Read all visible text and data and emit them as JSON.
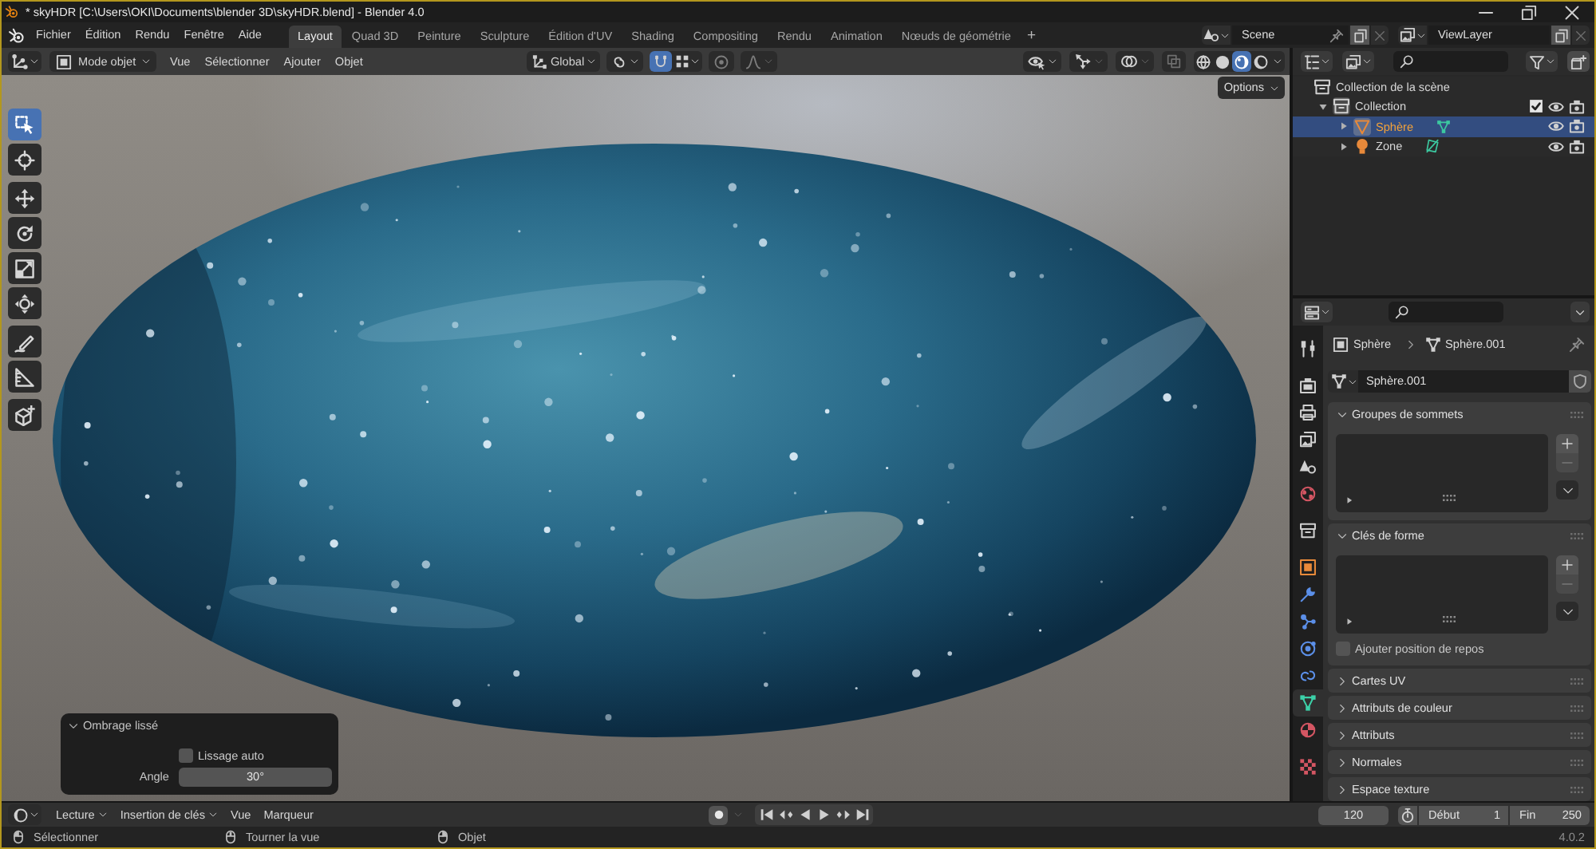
{
  "window": {
    "title": "* skyHDR [C:\\Users\\OKI\\Documents\\blender 3D\\skyHDR.blend] - Blender 4.0"
  },
  "menu": [
    "Fichier",
    "Édition",
    "Rendu",
    "Fenêtre",
    "Aide"
  ],
  "workspaces": [
    {
      "label": "Layout",
      "selected": true
    },
    {
      "label": "Quad 3D",
      "selected": false
    },
    {
      "label": "Peinture",
      "selected": false
    },
    {
      "label": "Sculpture",
      "selected": false
    },
    {
      "label": "Édition d'UV",
      "selected": false
    },
    {
      "label": "Shading",
      "selected": false
    },
    {
      "label": "Compositing",
      "selected": false
    },
    {
      "label": "Rendu",
      "selected": false
    },
    {
      "label": "Animation",
      "selected": false
    },
    {
      "label": "Nœuds de géométrie",
      "selected": false
    }
  ],
  "add_workspace": "+",
  "scene": {
    "value": "Scene"
  },
  "view_layer": {
    "value": "ViewLayer"
  },
  "viewport": {
    "mode": "Mode objet",
    "menus": [
      "Vue",
      "Sélectionner",
      "Ajouter",
      "Objet"
    ],
    "orientation": "Global",
    "snap": {
      "on": true
    },
    "shading": [
      {
        "kind": "wireframe",
        "selected": false
      },
      {
        "kind": "solid",
        "selected": false
      },
      {
        "kind": "material",
        "selected": true
      },
      {
        "kind": "rendered",
        "selected": false
      }
    ],
    "tool_groups": [
      [
        {
          "kind": "select_box",
          "selected": true
        },
        {
          "kind": "cursor",
          "selected": false
        }
      ],
      [
        {
          "kind": "move",
          "selected": false
        },
        {
          "kind": "rotate",
          "selected": false
        },
        {
          "kind": "scale",
          "selected": false
        },
        {
          "kind": "transform",
          "selected": false
        }
      ],
      [
        {
          "kind": "annotate",
          "selected": false
        },
        {
          "kind": "measure",
          "selected": false
        }
      ],
      [
        {
          "kind": "add_cube",
          "selected": false
        }
      ]
    ],
    "options": "Options",
    "last_operator": {
      "title": "Ombrage lissé",
      "expanded": true,
      "auto_smooth": {
        "label": "Lissage auto",
        "checked": false
      },
      "angle": {
        "label": "Angle",
        "value": "30°"
      }
    }
  },
  "outliner": {
    "tree": [
      {
        "label": "Collection de la scène",
        "children": [
          {
            "label": "Collection",
            "expanded": true,
            "checked": true,
            "children": [
              {
                "label": "Sphère",
                "kind": "mesh",
                "selected": true,
                "expanded": false
              },
              {
                "label": "Zone",
                "kind": "light",
                "selected": false,
                "expanded": false
              }
            ]
          }
        ]
      }
    ]
  },
  "properties": {
    "tab_groups": [
      [
        {
          "kind": "tool",
          "selected": false
        }
      ],
      [
        {
          "kind": "render",
          "selected": false
        },
        {
          "kind": "output",
          "selected": false
        },
        {
          "kind": "view_layer",
          "selected": false
        },
        {
          "kind": "scene",
          "selected": false
        },
        {
          "kind": "world",
          "selected": false
        }
      ],
      [
        {
          "kind": "collection",
          "selected": false
        }
      ],
      [
        {
          "kind": "object",
          "selected": false
        },
        {
          "kind": "modifiers",
          "selected": false
        },
        {
          "kind": "particles",
          "selected": false
        },
        {
          "kind": "physics",
          "selected": false
        },
        {
          "kind": "constraints",
          "selected": false
        },
        {
          "kind": "data",
          "selected": true
        },
        {
          "kind": "material",
          "selected": false
        }
      ],
      [
        {
          "kind": "texture",
          "selected": false
        }
      ]
    ],
    "breadcrumb": [
      "Sphère",
      "Sphère.001"
    ],
    "mesh": {
      "value": "Sphère.001"
    },
    "panels": [
      {
        "title": "Groupes de sommets",
        "expanded": true,
        "kind": "list"
      },
      {
        "title": "Clés de forme",
        "expanded": true,
        "kind": "list",
        "checkbox": {
          "label": "Ajouter position de repos",
          "checked": false
        }
      },
      {
        "title": "Cartes UV",
        "expanded": false
      },
      {
        "title": "Attributs de couleur",
        "expanded": false
      },
      {
        "title": "Attributs",
        "expanded": false
      },
      {
        "title": "Normales",
        "expanded": false
      },
      {
        "title": "Espace texture",
        "expanded": false
      }
    ]
  },
  "timeline": {
    "menus": [
      {
        "label": "Lecture",
        "kind": "dropdown"
      },
      {
        "label": "Insertion de clés",
        "kind": "dropdown"
      },
      {
        "label": "Vue",
        "kind": "menu"
      },
      {
        "label": "Marqueur",
        "kind": "menu"
      }
    ],
    "current_frame": "120",
    "start": {
      "label": "Début",
      "value": "1"
    },
    "end": {
      "label": "Fin",
      "value": "250"
    }
  },
  "status_bar": {
    "hints": [
      {
        "kind": "left",
        "label": "Sélectionner"
      },
      {
        "kind": "middle",
        "label": "Tourner la vue"
      },
      {
        "kind": "right",
        "label": "Objet"
      }
    ],
    "version": "4.0.2"
  }
}
